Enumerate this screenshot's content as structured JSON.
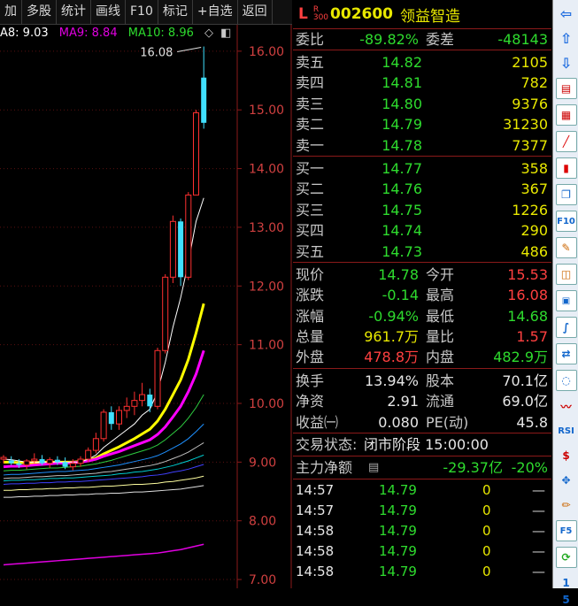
{
  "toolbar": {
    "items": [
      "加",
      "多股",
      "统计",
      "画线",
      "F10",
      "标记",
      "+自选",
      "返回"
    ]
  },
  "ma_legend": {
    "ma8": "A8: 9.03",
    "ma9": "MA9: 8.84",
    "ma10": "MA10: 8.96"
  },
  "chart_data": {
    "type": "candlestick",
    "y_ticks": [
      "16.00",
      "15.00",
      "14.00",
      "13.00",
      "12.00",
      "11.00",
      "10.00",
      "9.00",
      "8.00",
      "7.00"
    ],
    "ylim": [
      6.85,
      16.45
    ],
    "high_annotation": "16.08",
    "candles": [
      {
        "o": 9.05,
        "h": 9.12,
        "l": 8.98,
        "c": 9.08
      },
      {
        "o": 9.03,
        "h": 9.1,
        "l": 8.95,
        "c": 8.98
      },
      {
        "o": 8.98,
        "h": 9.05,
        "l": 8.9,
        "c": 8.95
      },
      {
        "o": 8.95,
        "h": 9.05,
        "l": 8.88,
        "c": 9.02
      },
      {
        "o": 9.02,
        "h": 9.15,
        "l": 8.98,
        "c": 9.05
      },
      {
        "o": 9.05,
        "h": 9.12,
        "l": 8.95,
        "c": 8.98
      },
      {
        "o": 8.98,
        "h": 9.08,
        "l": 8.9,
        "c": 9.04
      },
      {
        "o": 9.04,
        "h": 9.1,
        "l": 8.95,
        "c": 9.0
      },
      {
        "o": 9.0,
        "h": 9.08,
        "l": 8.88,
        "c": 8.92
      },
      {
        "o": 8.92,
        "h": 9.05,
        "l": 8.86,
        "c": 8.98
      },
      {
        "o": 8.98,
        "h": 9.1,
        "l": 8.92,
        "c": 9.05
      },
      {
        "o": 9.05,
        "h": 9.25,
        "l": 9.0,
        "c": 9.2
      },
      {
        "o": 9.2,
        "h": 9.5,
        "l": 9.15,
        "c": 9.4
      },
      {
        "o": 9.4,
        "h": 9.9,
        "l": 9.35,
        "c": 9.85
      },
      {
        "o": 9.85,
        "h": 9.95,
        "l": 9.55,
        "c": 9.65
      },
      {
        "o": 9.65,
        "h": 9.95,
        "l": 9.55,
        "c": 9.88
      },
      {
        "o": 9.88,
        "h": 10.1,
        "l": 9.75,
        "c": 9.95
      },
      {
        "o": 9.95,
        "h": 10.2,
        "l": 9.8,
        "c": 10.05
      },
      {
        "o": 10.05,
        "h": 10.35,
        "l": 9.95,
        "c": 10.15
      },
      {
        "o": 10.15,
        "h": 10.25,
        "l": 9.85,
        "c": 9.95
      },
      {
        "o": 9.95,
        "h": 10.95,
        "l": 9.9,
        "c": 10.9
      },
      {
        "o": 10.9,
        "h": 12.2,
        "l": 10.85,
        "c": 12.15
      },
      {
        "o": 12.15,
        "h": 13.2,
        "l": 12.05,
        "c": 13.1
      },
      {
        "o": 13.1,
        "h": 13.15,
        "l": 12.0,
        "c": 12.15
      },
      {
        "o": 12.15,
        "h": 13.6,
        "l": 12.1,
        "c": 13.55
      },
      {
        "o": 13.55,
        "h": 15.0,
        "l": 13.7,
        "c": 14.95
      },
      {
        "o": 15.55,
        "h": 16.08,
        "l": 14.68,
        "c": 14.78
      }
    ],
    "ma_lines": [
      {
        "color": "#ffff00",
        "width": 3,
        "values": [
          9.0,
          9.0,
          8.99,
          8.99,
          8.99,
          9.0,
          9.0,
          9.0,
          9.0,
          9.0,
          9.01,
          9.03,
          9.07,
          9.14,
          9.2,
          9.26,
          9.33,
          9.4,
          9.48,
          9.56,
          9.7,
          9.9,
          10.15,
          10.4,
          10.75,
          11.2,
          11.7
        ]
      },
      {
        "color": "#ff00ff",
        "width": 3,
        "values": [
          8.92,
          8.93,
          8.93,
          8.94,
          8.95,
          8.96,
          8.97,
          8.98,
          8.98,
          8.99,
          9.0,
          9.02,
          9.05,
          9.1,
          9.14,
          9.18,
          9.23,
          9.28,
          9.33,
          9.38,
          9.47,
          9.6,
          9.77,
          9.95,
          10.2,
          10.5,
          10.9
        ]
      },
      {
        "color": "#ffffff",
        "width": 1,
        "values": [
          9.05,
          9.04,
          9.02,
          9.0,
          9.0,
          9.0,
          9.0,
          9.0,
          9.0,
          8.99,
          9.0,
          9.05,
          9.12,
          9.25,
          9.35,
          9.45,
          9.55,
          9.65,
          9.8,
          9.9,
          10.2,
          10.7,
          11.3,
          11.8,
          12.4,
          13.1,
          13.5
        ]
      },
      {
        "color": "#2ecc40",
        "width": 1,
        "values": [
          8.85,
          8.86,
          8.86,
          8.87,
          8.88,
          8.89,
          8.9,
          8.9,
          8.91,
          8.92,
          8.93,
          8.95,
          8.97,
          9.0,
          9.03,
          9.07,
          9.11,
          9.15,
          9.19,
          9.23,
          9.29,
          9.38,
          9.49,
          9.6,
          9.75,
          9.93,
          10.15
        ]
      },
      {
        "color": "#1e90ff",
        "width": 1,
        "values": [
          8.78,
          8.79,
          8.79,
          8.8,
          8.81,
          8.82,
          8.83,
          8.84,
          8.84,
          8.85,
          8.86,
          8.87,
          8.89,
          8.91,
          8.93,
          8.95,
          8.98,
          9.01,
          9.04,
          9.07,
          9.11,
          9.17,
          9.24,
          9.31,
          9.4,
          9.52,
          9.65
        ]
      },
      {
        "color": "#c0c0c0",
        "width": 1,
        "values": [
          8.72,
          8.73,
          8.73,
          8.74,
          8.75,
          8.75,
          8.76,
          8.77,
          8.77,
          8.78,
          8.79,
          8.8,
          8.81,
          8.83,
          8.84,
          8.86,
          8.88,
          8.9,
          8.92,
          8.94,
          8.97,
          9.01,
          9.06,
          9.11,
          9.17,
          9.25,
          9.33
        ]
      },
      {
        "color": "#00ced1",
        "width": 1,
        "values": [
          8.68,
          8.69,
          8.69,
          8.7,
          8.7,
          8.71,
          8.72,
          8.72,
          8.73,
          8.73,
          8.74,
          8.75,
          8.76,
          8.77,
          8.78,
          8.8,
          8.81,
          8.83,
          8.84,
          8.86,
          8.88,
          8.91,
          8.94,
          8.98,
          9.02,
          9.07,
          9.12
        ]
      },
      {
        "color": "#4040ff",
        "width": 1,
        "values": [
          8.62,
          8.63,
          8.63,
          8.64,
          8.64,
          8.65,
          8.65,
          8.66,
          8.66,
          8.67,
          8.67,
          8.68,
          8.69,
          8.7,
          8.71,
          8.72,
          8.73,
          8.74,
          8.75,
          8.77,
          8.78,
          8.8,
          8.83,
          8.85,
          8.88,
          8.92,
          8.96
        ]
      },
      {
        "color": "#ffffa0",
        "width": 1,
        "values": [
          8.52,
          8.52,
          8.53,
          8.53,
          8.54,
          8.54,
          8.55,
          8.55,
          8.56,
          8.56,
          8.57,
          8.57,
          8.58,
          8.59,
          8.59,
          8.6,
          8.61,
          8.62,
          8.62,
          8.63,
          8.64,
          8.66,
          8.67,
          8.69,
          8.71,
          8.73,
          8.76
        ]
      },
      {
        "color": "#e0e0e0",
        "width": 1,
        "values": [
          8.4,
          8.4,
          8.41,
          8.41,
          8.42,
          8.42,
          8.43,
          8.43,
          8.44,
          8.44,
          8.45,
          8.45,
          8.46,
          8.46,
          8.47,
          8.47,
          8.48,
          8.49,
          8.49,
          8.5,
          8.51,
          8.52,
          8.53,
          8.54,
          8.56,
          8.58,
          8.6
        ]
      },
      {
        "color": "#e000e0",
        "width": 1.5,
        "values": [
          7.25,
          7.26,
          7.27,
          7.28,
          7.29,
          7.3,
          7.31,
          7.32,
          7.33,
          7.34,
          7.35,
          7.36,
          7.37,
          7.38,
          7.39,
          7.4,
          7.41,
          7.42,
          7.43,
          7.44,
          7.45,
          7.47,
          7.49,
          7.51,
          7.54,
          7.57,
          7.6
        ]
      }
    ]
  },
  "quote": {
    "market_tag": "L",
    "badge_top": "R",
    "badge_bottom": "300",
    "code": "002600",
    "name": "领益智造",
    "weibi_label": "委比",
    "weibi_value": "-89.82%",
    "weicha_label": "委差",
    "weicha_value": "-48143",
    "asks": [
      {
        "label": "卖五",
        "price": "14.82",
        "vol": "2105"
      },
      {
        "label": "卖四",
        "price": "14.81",
        "vol": "782"
      },
      {
        "label": "卖三",
        "price": "14.80",
        "vol": "9376"
      },
      {
        "label": "卖二",
        "price": "14.79",
        "vol": "31230"
      },
      {
        "label": "卖一",
        "price": "14.78",
        "vol": "7377"
      }
    ],
    "bids": [
      {
        "label": "买一",
        "price": "14.77",
        "vol": "358"
      },
      {
        "label": "买二",
        "price": "14.76",
        "vol": "367"
      },
      {
        "label": "买三",
        "price": "14.75",
        "vol": "1226"
      },
      {
        "label": "买四",
        "price": "14.74",
        "vol": "290"
      },
      {
        "label": "买五",
        "price": "14.73",
        "vol": "486"
      }
    ],
    "stats": [
      {
        "l1": "现价",
        "v1": "14.78",
        "c1": "green",
        "l2": "今开",
        "v2": "15.53",
        "c2": "red"
      },
      {
        "l1": "涨跌",
        "v1": "-0.14",
        "c1": "green",
        "l2": "最高",
        "v2": "16.08",
        "c2": "red"
      },
      {
        "l1": "涨幅",
        "v1": "-0.94%",
        "c1": "green",
        "l2": "最低",
        "v2": "14.68",
        "c2": "green"
      },
      {
        "l1": "总量",
        "v1": "961.7万",
        "c1": "yellow",
        "l2": "量比",
        "v2": "1.57",
        "c2": "red"
      },
      {
        "l1": "外盘",
        "v1": "478.8万",
        "c1": "red",
        "l2": "内盘",
        "v2": "482.9万",
        "c2": "green"
      }
    ],
    "fund": [
      {
        "l1": "换手",
        "v1": "13.94%",
        "l2": "股本",
        "v2": "70.1亿"
      },
      {
        "l1": "净资",
        "v1": "2.91",
        "l2": "流通",
        "v2": "69.0亿"
      },
      {
        "l1": "收益㈠",
        "v1": "0.080",
        "l2": "PE(动)",
        "v2": "45.8"
      }
    ],
    "status_label": "交易状态:",
    "status_value": "闭市阶段 15:00:00",
    "flow_label": "主力净额",
    "flow_value": "-29.37亿",
    "flow_pct": "-20%",
    "ticks": [
      {
        "time": "14:57",
        "price": "14.79",
        "vol": "0",
        "flag": "—"
      },
      {
        "time": "14:57",
        "price": "14.79",
        "vol": "0",
        "flag": "—"
      },
      {
        "time": "14:58",
        "price": "14.79",
        "vol": "0",
        "flag": "—"
      },
      {
        "time": "14:58",
        "price": "14.79",
        "vol": "0",
        "flag": "—"
      },
      {
        "time": "14:58",
        "price": "14.79",
        "vol": "0",
        "flag": "—"
      }
    ]
  },
  "sidebar": {
    "tools": [
      "F10",
      "F5",
      "RSI",
      "1",
      "5"
    ]
  },
  "colors": {
    "up": "#ff4040",
    "down": "#2edb2e",
    "background": "#000000",
    "divider": "#8b1a1a"
  }
}
